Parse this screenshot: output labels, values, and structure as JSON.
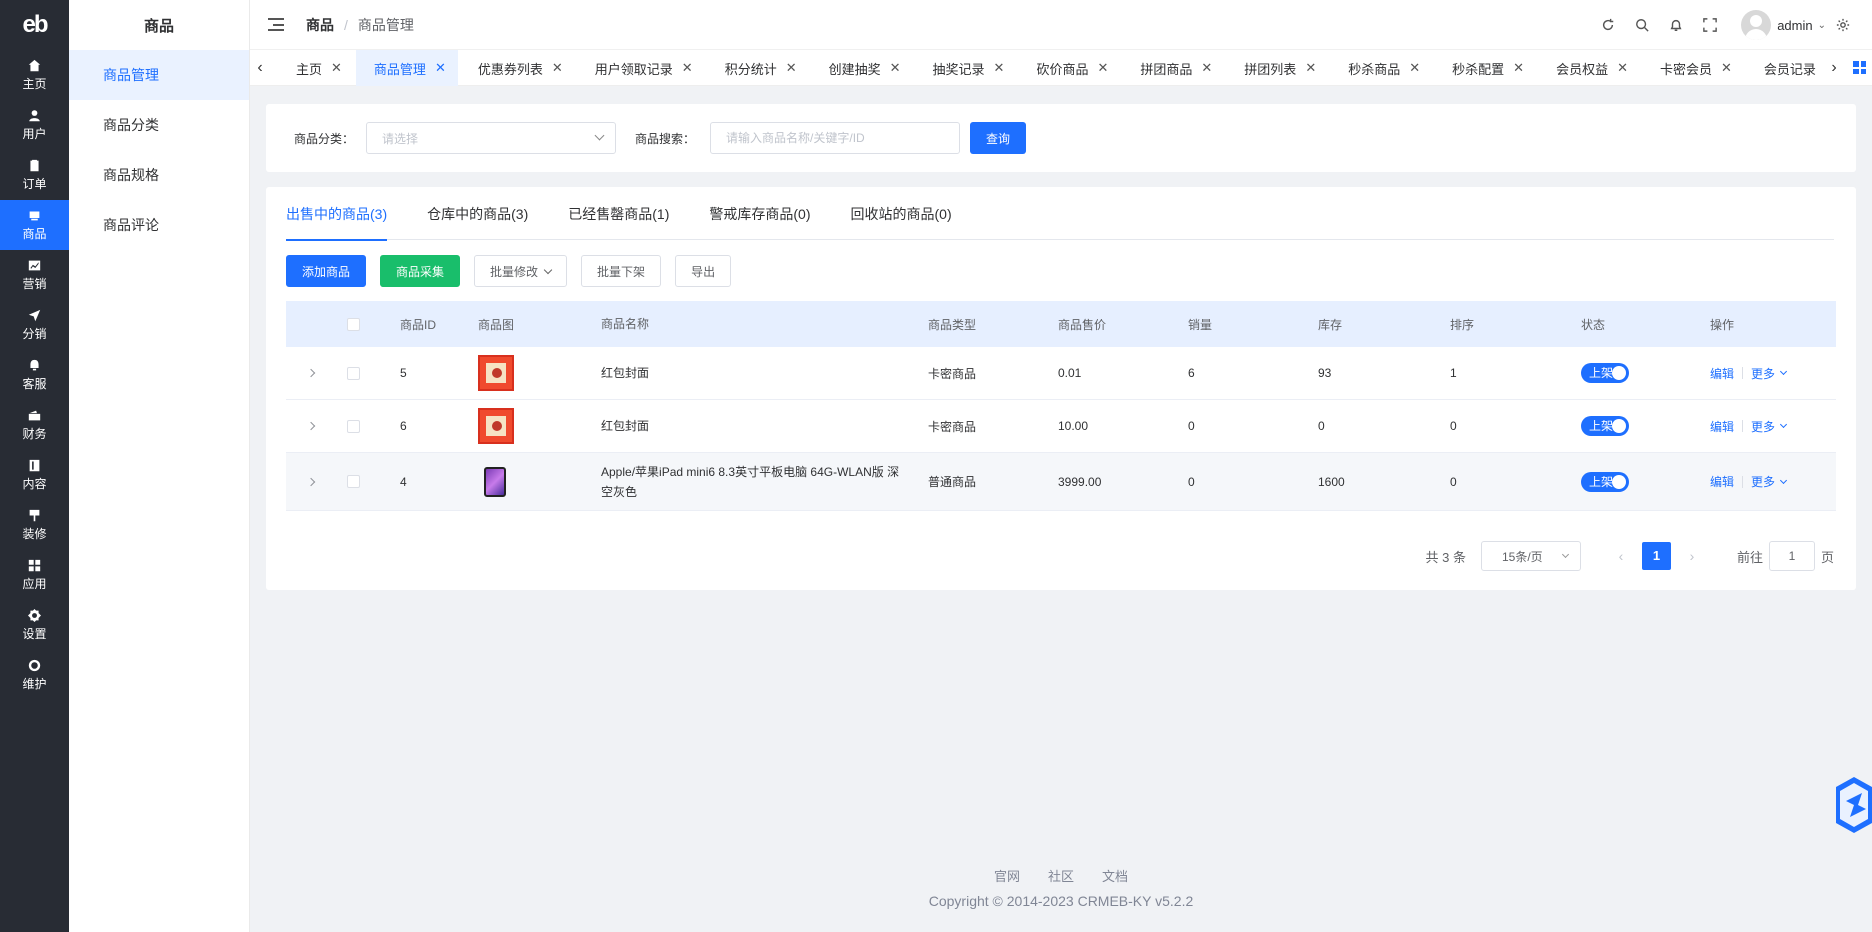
{
  "rail": {
    "logo": "eb",
    "items": [
      {
        "label": "主页",
        "icon": "home-icon"
      },
      {
        "label": "用户",
        "icon": "user-icon"
      },
      {
        "label": "订单",
        "icon": "order-icon"
      },
      {
        "label": "商品",
        "icon": "product-icon"
      },
      {
        "label": "营销",
        "icon": "marketing-icon"
      },
      {
        "label": "分销",
        "icon": "distribution-icon"
      },
      {
        "label": "客服",
        "icon": "service-icon"
      },
      {
        "label": "财务",
        "icon": "finance-icon"
      },
      {
        "label": "内容",
        "icon": "content-icon"
      },
      {
        "label": "装修",
        "icon": "decoration-icon"
      },
      {
        "label": "应用",
        "icon": "apps-icon"
      },
      {
        "label": "设置",
        "icon": "settings-icon"
      },
      {
        "label": "维护",
        "icon": "maintain-icon"
      }
    ]
  },
  "submenu": {
    "title": "商品",
    "items": [
      "商品管理",
      "商品分类",
      "商品规格",
      "商品评论"
    ]
  },
  "header": {
    "crumb1": "商品",
    "crumb_sep": "/",
    "crumb2": "商品管理",
    "username": "admin"
  },
  "tabs": [
    "主页",
    "商品管理",
    "优惠券列表",
    "用户领取记录",
    "积分统计",
    "创建抽奖",
    "抽奖记录",
    "砍价商品",
    "拼团商品",
    "拼团列表",
    "秒杀商品",
    "秒杀配置",
    "会员权益",
    "卡密会员",
    "会员记录"
  ],
  "filter": {
    "category_label": "商品分类：",
    "category_placeholder": "请选择",
    "search_label": "商品搜索：",
    "search_placeholder": "请输入商品名称/关键字/ID",
    "query_button": "查询"
  },
  "status_tabs": [
    "出售中的商品(3)",
    "仓库中的商品(3)",
    "已经售罄商品(1)",
    "警戒库存商品(0)",
    "回收站的商品(0)"
  ],
  "actions": {
    "add": "添加商品",
    "collect": "商品采集",
    "batch_edit": "批量修改",
    "batch_off": "批量下架",
    "export": "导出"
  },
  "table": {
    "headers": {
      "id": "商品ID",
      "img": "商品图",
      "name": "商品名称",
      "type": "商品类型",
      "price": "商品售价",
      "sales": "销量",
      "stock": "库存",
      "sort": "排序",
      "status": "状态",
      "ops": "操作"
    },
    "rows": [
      {
        "id": "5",
        "name": "红包封面",
        "type": "卡密商品",
        "price": "0.01",
        "sales": "6",
        "stock": "93",
        "sort": "1",
        "status": "上架",
        "edit": "编辑",
        "more": "更多"
      },
      {
        "id": "6",
        "name": "红包封面",
        "type": "卡密商品",
        "price": "10.00",
        "sales": "0",
        "stock": "0",
        "sort": "0",
        "status": "上架",
        "edit": "编辑",
        "more": "更多"
      },
      {
        "id": "4",
        "name": "Apple/苹果iPad mini6 8.3英寸平板电脑 64G-WLAN版 深空灰色",
        "type": "普通商品",
        "price": "3999.00",
        "sales": "0",
        "stock": "1600",
        "sort": "0",
        "status": "上架",
        "edit": "编辑",
        "more": "更多"
      }
    ]
  },
  "pager": {
    "total": "共 3 条",
    "page_size": "15条/页",
    "current": "1",
    "goto_label": "前往",
    "goto_value": "1",
    "page_unit": "页"
  },
  "footer": {
    "links": [
      "官网",
      "社区",
      "文档"
    ],
    "copyright": "Copyright © 2014-2023 CRMEB-KY v5.2.2"
  },
  "colors": {
    "accent": "#1e6fff",
    "success": "#19be6b",
    "rail_bg": "#282c34"
  }
}
